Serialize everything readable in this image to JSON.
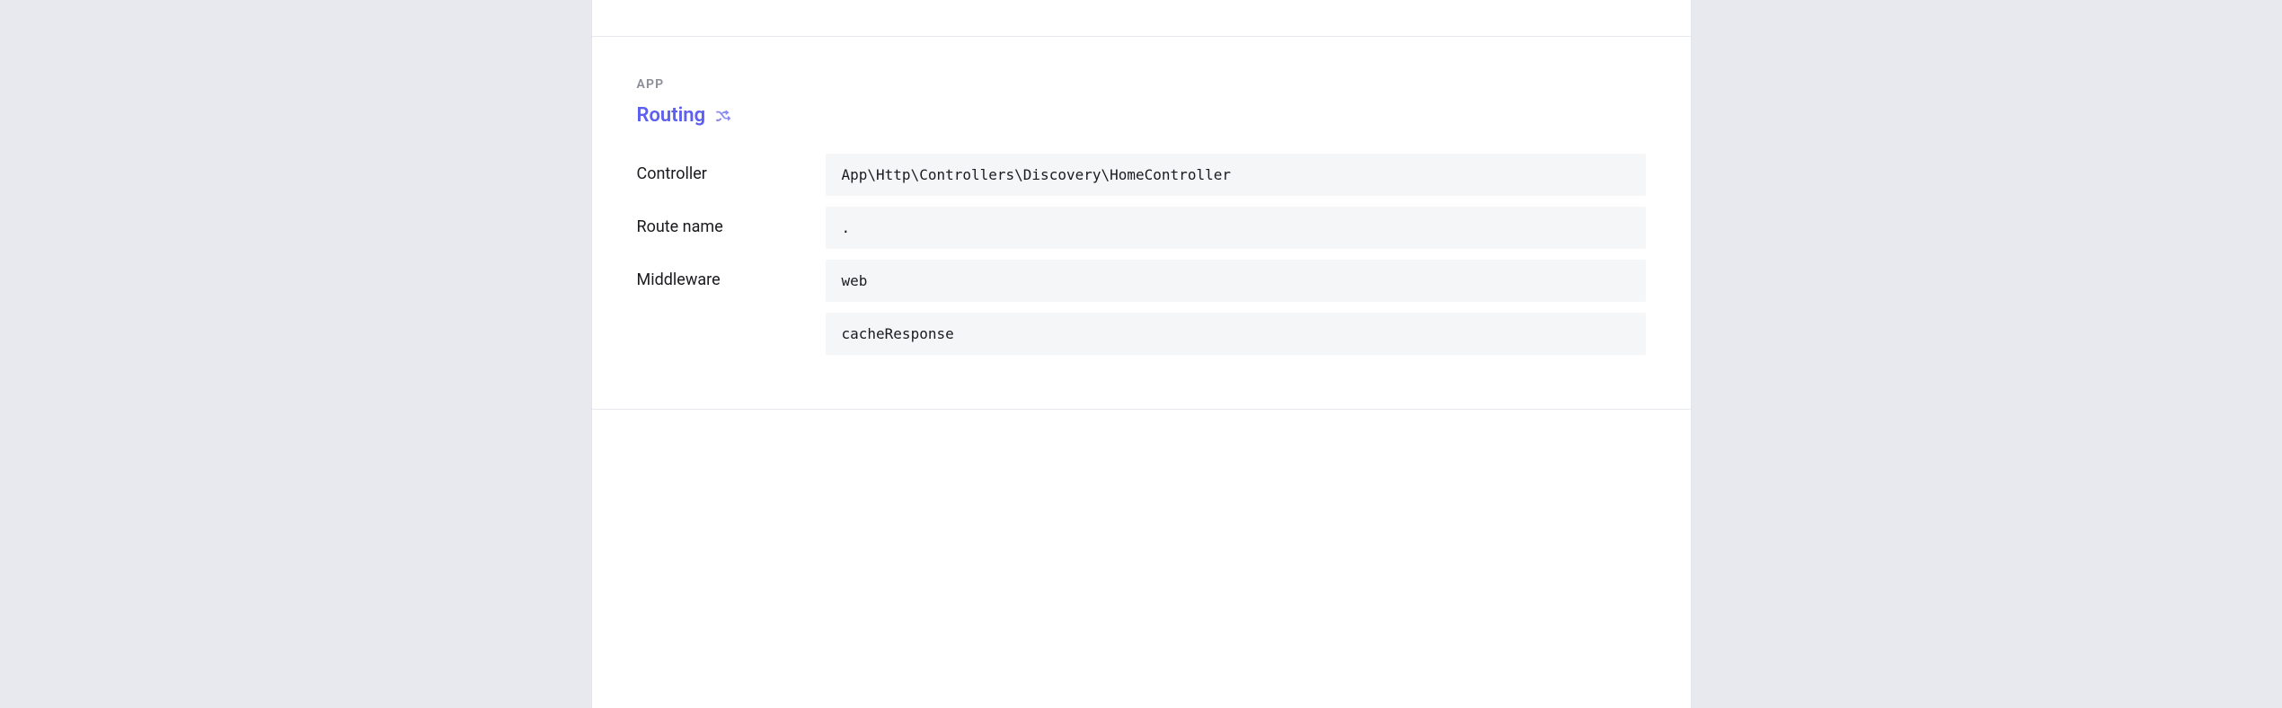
{
  "section": {
    "eyebrow": "APP",
    "title": "Routing",
    "icon": "shuffle-icon"
  },
  "rows": [
    {
      "label": "Controller",
      "values": [
        "App\\Http\\Controllers\\Discovery\\HomeController"
      ]
    },
    {
      "label": "Route name",
      "values": [
        "."
      ]
    },
    {
      "label": "Middleware",
      "values": [
        "web",
        "cacheResponse"
      ]
    }
  ]
}
